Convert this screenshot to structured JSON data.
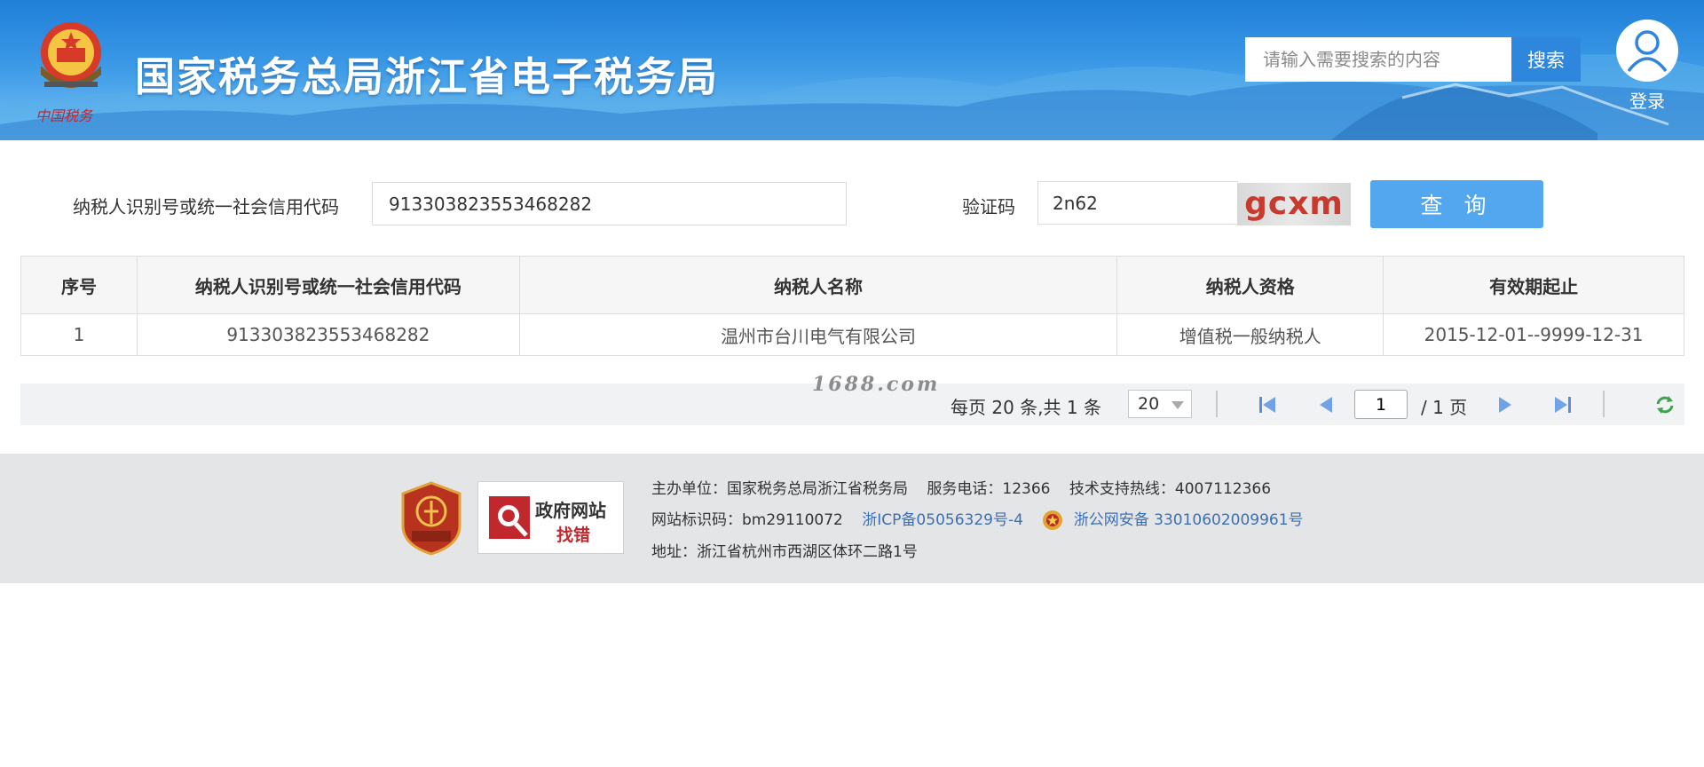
{
  "header": {
    "title": "国家税务总局浙江省电子税务局",
    "search_placeholder": "请输入需要搜索的内容",
    "search_button": "搜索",
    "login_label": "登录"
  },
  "form": {
    "tax_id_label": "纳税人识别号或统一社会信用代码",
    "tax_id_value": "913303823553468282",
    "captcha_label": "验证码",
    "captcha_value": "2n62",
    "captcha_image_text": "gcxm",
    "query_button": "查 询"
  },
  "table": {
    "headers": [
      "序号",
      "纳税人识别号或统一社会信用代码",
      "纳税人名称",
      "纳税人资格",
      "有效期起止"
    ],
    "rows": [
      [
        "1",
        "913303823553468282",
        "温州市台川电气有限公司",
        "增值税一般纳税人",
        "2015-12-01--9999-12-31"
      ]
    ]
  },
  "pagination": {
    "summary": "每页 20 条,共 1 条",
    "page_size": "20",
    "current_page": "1",
    "total_pages": "/ 1 页",
    "watermark": "1688.com"
  },
  "footer": {
    "badge2_title": "政府网站",
    "badge2_sub": "找错",
    "host": "主办单位：国家税务总局浙江省税务局",
    "service_phone": "服务电话：12366",
    "tech_hotline": "技术支持热线：4007112366",
    "site_id": "网站标识码：bm29110072",
    "icp": "浙ICP备05056329号-4",
    "police": "浙公网安备 33010602009961号",
    "address": "地址：浙江省杭州市西湖区体环二路1号"
  },
  "colors": {
    "header_blue": "#2f86dd",
    "query_button": "#53a7ee",
    "captcha_text": "#c8392e",
    "link": "#3b6fb6",
    "footer_bg": "#e4e5e7"
  },
  "icons": [
    "national-emblem-icon",
    "user-avatar-icon",
    "first-page-icon",
    "prev-page-icon",
    "next-page-icon",
    "last-page-icon",
    "refresh-icon",
    "police-badge-icon",
    "party-org-badge-icon",
    "magnifier-icon"
  ]
}
